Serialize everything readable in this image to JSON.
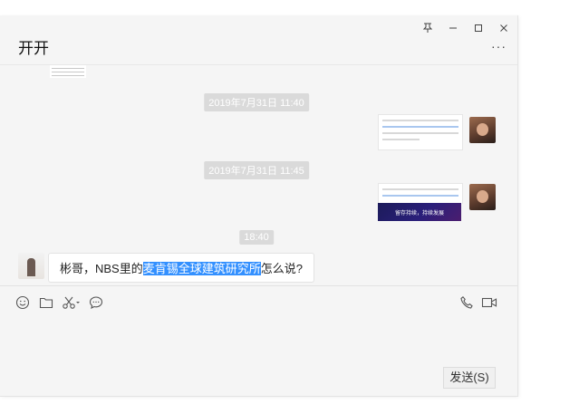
{
  "window": {
    "title": "开开",
    "more_label": "···"
  },
  "controls": {
    "pin": "pin",
    "minimize": "minimize",
    "maximize": "maximize",
    "close": "close"
  },
  "timestamps": [
    "2019年7月31日 11:40",
    "2019年7月31日 11:45",
    "18:40"
  ],
  "message": {
    "prefix": "彬哥，NBS里的",
    "highlight": "麦肯锡全球建筑研究所",
    "suffix": "怎么说?"
  },
  "dark_card": {
    "line1": "留存持续，持续发展"
  },
  "toolbar": {
    "left_icons": [
      "emoji-icon",
      "folder-icon",
      "scissors-icon",
      "chat-history-icon"
    ],
    "right_icons": [
      "phone-icon",
      "video-icon"
    ]
  },
  "send_button": "发送(S)",
  "colors": {
    "highlight": "#3390ff",
    "window_bg": "#f5f5f5",
    "time_pill": "#dadada"
  }
}
